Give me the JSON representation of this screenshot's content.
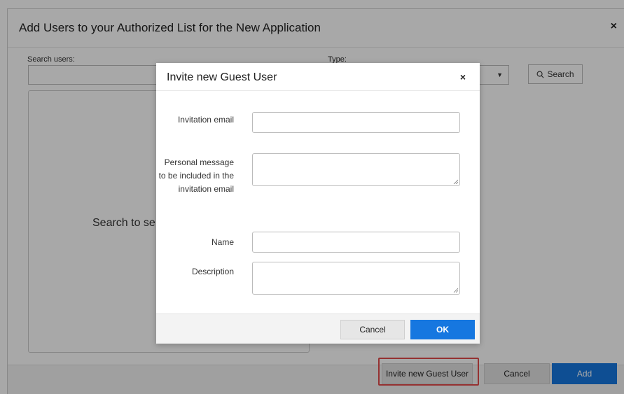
{
  "outer_dialog": {
    "title": "Add Users to your Authorized List for the New Application",
    "close_glyph": "×",
    "search_label": "Search users:",
    "search_value": "",
    "type_label": "Type:",
    "type_value": "",
    "search_button_label": "Search",
    "results_placeholder": "Search to se",
    "footer": {
      "invite_label": "Invite new Guest User",
      "cancel_label": "Cancel",
      "add_label": "Add"
    }
  },
  "modal": {
    "title": "Invite new Guest User",
    "close_glyph": "×",
    "fields": [
      {
        "label": "Invitation email",
        "value": ""
      },
      {
        "label": "Personal message to be included in the invitation email",
        "value": ""
      },
      {
        "label": "Name",
        "value": ""
      },
      {
        "label": "Description",
        "value": ""
      }
    ],
    "cancel_label": "Cancel",
    "ok_label": "OK"
  },
  "icons": {
    "search": "search-icon",
    "dropdown": "caret-down-icon",
    "close": "close-icon",
    "resize": "resize-grip-icon"
  },
  "colors": {
    "primary": "#1677e0",
    "highlight": "#e24b4b",
    "overlay": "rgba(0,0,0,0.34)"
  }
}
